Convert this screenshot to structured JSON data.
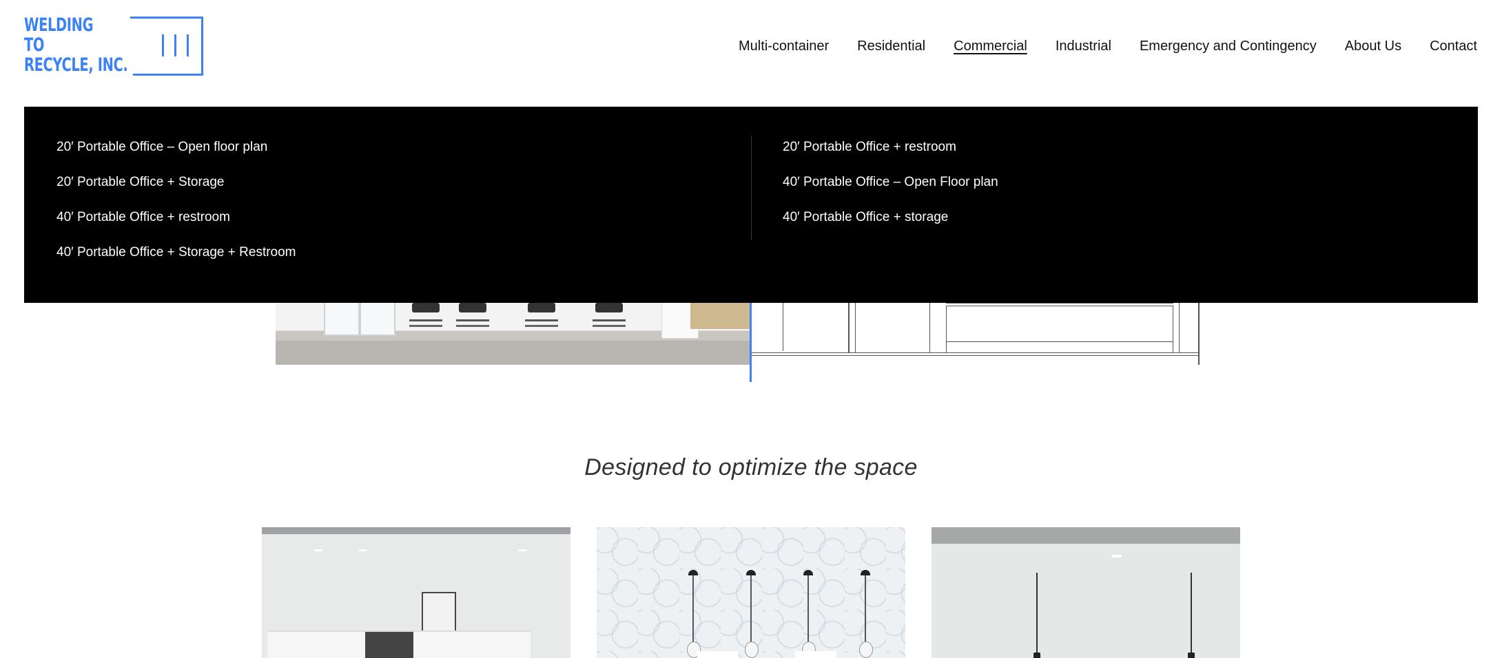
{
  "brand": {
    "logo_lines": [
      "WELDING",
      "TO",
      "RECYCLE, INC."
    ],
    "accent_color": "#3b82f6"
  },
  "nav": {
    "items": [
      {
        "label": "Multi-container",
        "active": false
      },
      {
        "label": "Residential",
        "active": false
      },
      {
        "label": "Commercial",
        "active": true
      },
      {
        "label": "Industrial",
        "active": false
      },
      {
        "label": "Emergency and Contingency",
        "active": false
      },
      {
        "label": "About Us",
        "active": false
      },
      {
        "label": "Contact",
        "active": false
      }
    ]
  },
  "dropdown": {
    "left": [
      "20′ Portable Office – Open floor plan",
      "20′ Portable Office + Storage",
      "40′ Portable Office + restroom",
      "40′ Portable Office + Storage + Restroom"
    ],
    "right": [
      "20′ Portable Office + restroom",
      "40′ Portable Office – Open Floor plan",
      "40′ Portable Office + storage"
    ]
  },
  "main": {
    "tagline": "Designed to optimize the space"
  },
  "gallery": {
    "card_count": 3
  },
  "colors": {
    "dropdown_bg": "#000000",
    "page_bg": "#ffffff"
  }
}
